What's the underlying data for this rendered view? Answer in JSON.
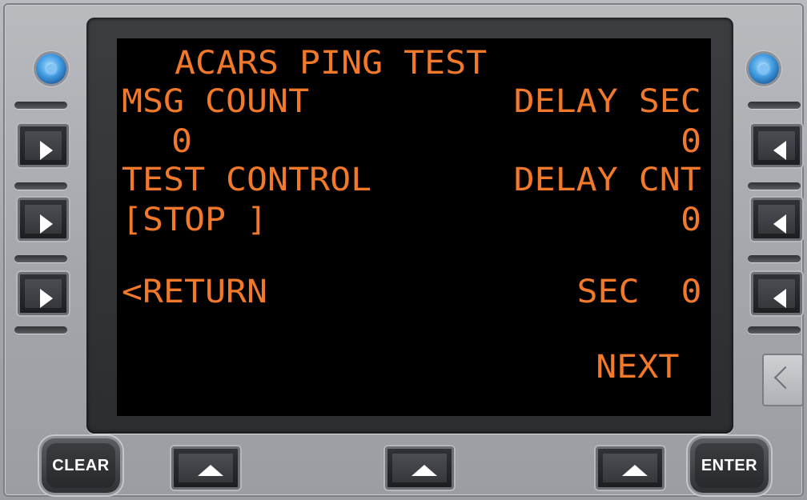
{
  "display": {
    "title": "ACARS PING TEST",
    "rows": {
      "l1_label": "MSG COUNT",
      "r1_label": "DELAY SEC",
      "l1_value": "0",
      "r1_value": "0",
      "l2_label": "TEST CONTROL",
      "r2_label": "DELAY CNT",
      "l2_value": "[STOP ]",
      "r2_value": "0",
      "l3_value": "<RETURN",
      "r3_value": "SEC  0",
      "r4_value": "NEXT"
    },
    "text_color": "#f2782a"
  },
  "keys": {
    "clear": "CLEAR",
    "enter": "ENTER"
  },
  "icons": {
    "lsk_left": "triangle-right-icon",
    "lsk_right": "triangle-left-icon",
    "bottom": "triangle-up-icon",
    "back": "chevron-left-icon",
    "knob": "brightness-knob-icon"
  }
}
